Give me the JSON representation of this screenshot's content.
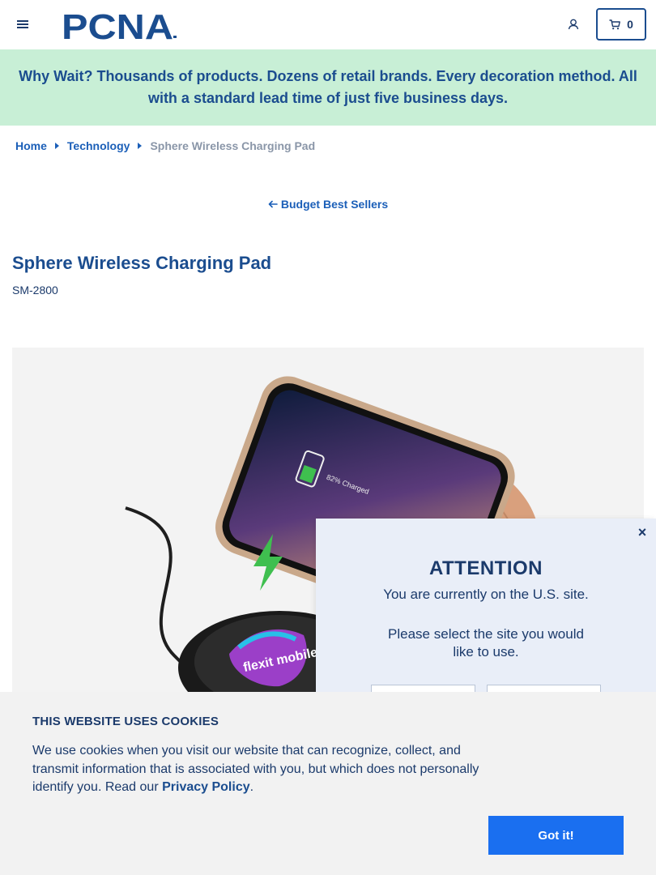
{
  "header": {
    "logo_text": "PCNA",
    "cart_count": "0"
  },
  "banner": {
    "text": "Why Wait? Thousands of products. Dozens of retail brands. Every decoration method. All with a standard lead time of just five business days."
  },
  "breadcrumb": {
    "items": [
      "Home",
      "Technology"
    ],
    "current": "Sphere Wireless Charging Pad"
  },
  "back_link": {
    "label": "Budget Best Sellers"
  },
  "product": {
    "title": "Sphere Wireless Charging Pad",
    "sku": "SM-2800",
    "image_brand": "flexit mobile",
    "phone_text": "82% Charged"
  },
  "attention_modal": {
    "heading": "ATTENTION",
    "message": "You are currently on the U.S. site.",
    "prompt": "Please select the site you would like to use.",
    "close_symbol": "×"
  },
  "cookie_banner": {
    "heading": "THIS WEBSITE USES COOKIES",
    "text_before": "We use cookies when you visit our website that can recognize, collect, and transmit information that is associated with you, but which does not personally identify you. Read our ",
    "policy_link": "Privacy Policy",
    "text_after": ".",
    "accept_label": "Got it!"
  },
  "colors": {
    "brand_blue": "#1b4d8f",
    "link_blue": "#1b5fb8",
    "banner_green": "#c8efd6",
    "button_blue": "#1a6ff0",
    "modal_bg": "#e9eef8",
    "cookie_bg": "#f2f2f2"
  }
}
